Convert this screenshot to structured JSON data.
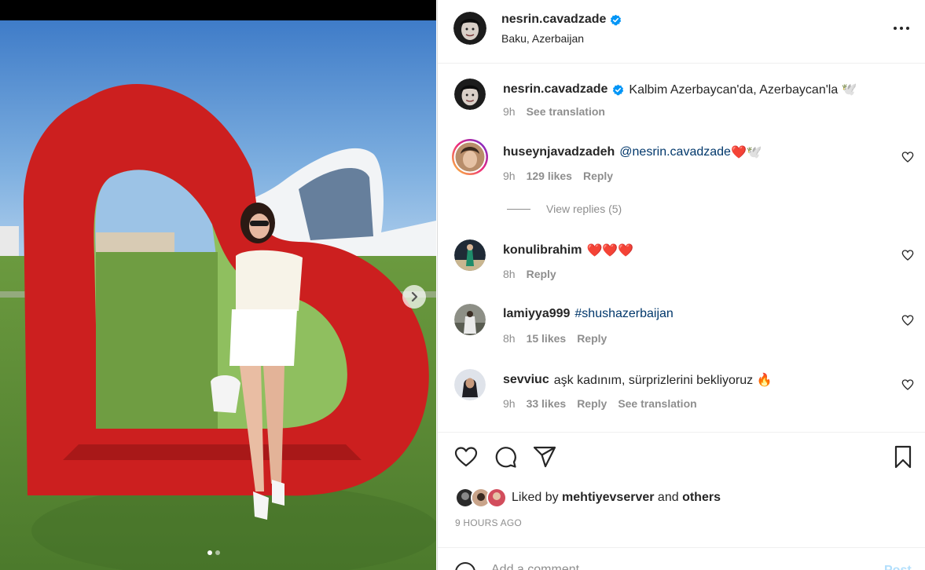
{
  "post": {
    "author": {
      "username": "nesrin.cavadzade",
      "verified": true,
      "location": "Baku, Azerbaijan",
      "avatar_icon": "avatar-icon"
    },
    "caption": {
      "username": "nesrin.cavadzade",
      "text": "Kalbim Azerbaycan'da, Azerbaycan'la 🕊️",
      "time": "9h",
      "translate_label": "See translation"
    },
    "comments": [
      {
        "username": "huseynjavadzadeh",
        "mention": "@nesrin.cavadzade",
        "text": " ❤️🕊️",
        "time": "9h",
        "likes": "129 likes",
        "reply_label": "Reply"
      },
      {
        "username": "konulibrahim",
        "text": "❤️❤️❤️",
        "time": "8h",
        "reply_label": "Reply"
      },
      {
        "username": "lamiyya999",
        "mention": "#shushazerbaijan",
        "time": "8h",
        "likes": "15 likes",
        "reply_label": "Reply"
      },
      {
        "username": "sevviuc",
        "text": "aşk kadınım, sürprizlerini bekliyoruz 🔥",
        "time": "9h",
        "likes": "33 likes",
        "reply_label": "Reply",
        "translate_label": "See translation"
      }
    ],
    "view_replies_label": "View replies (5)",
    "liked_by": {
      "prefix": "Liked by ",
      "user": "mehtiyevserver",
      "middle": " and ",
      "others": "others"
    },
    "timestamp": "9 HOURS AGO",
    "add_comment_placeholder": "Add a comment...",
    "post_label": "Post",
    "carousel": {
      "slide_count": 2,
      "active_index": 0
    }
  },
  "colors": {
    "text": "#262626",
    "secondary": "#8e8e8e",
    "link": "#00376b",
    "verified": "#0095f6",
    "heart_red": "#ed4956",
    "sculpture_red": "#cc1f1f"
  }
}
